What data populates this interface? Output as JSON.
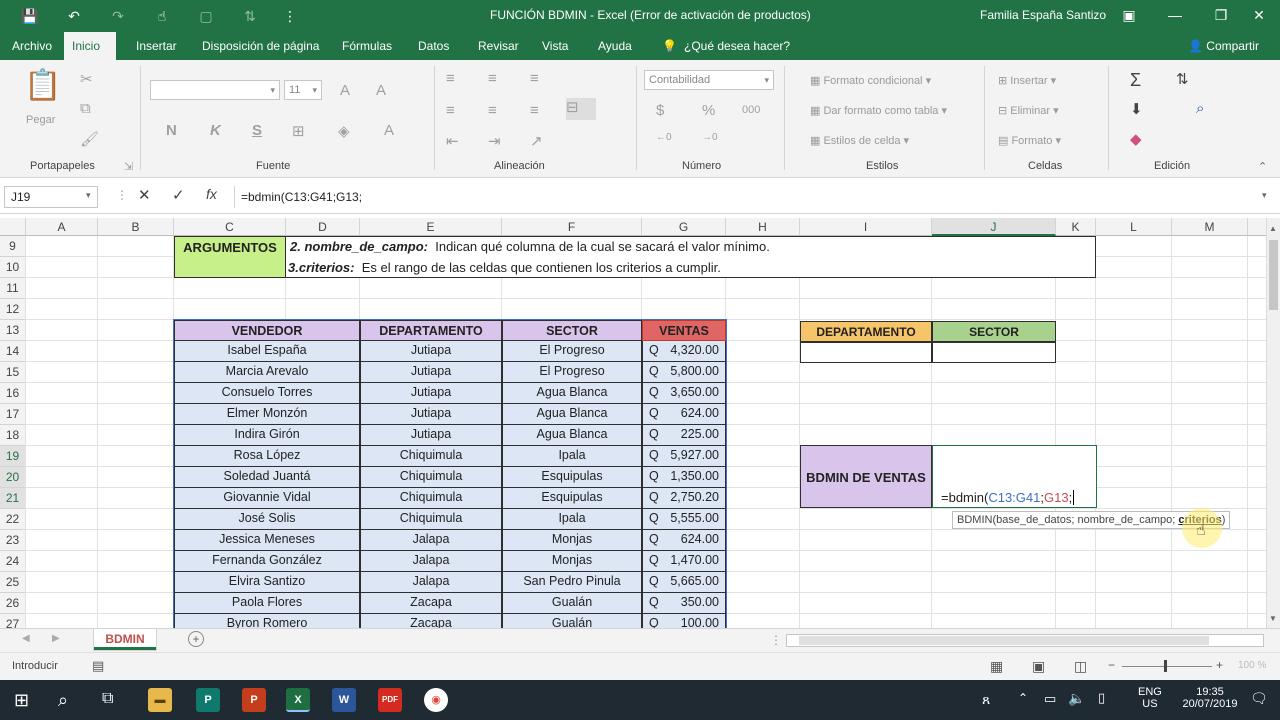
{
  "titlebar": {
    "title": "FUNCIÓN BDMIN  -  Excel (Error de activación de productos)",
    "user": "Familia España Santizo"
  },
  "tabs": [
    "Archivo",
    "Inicio",
    "Insertar",
    "Disposición de página",
    "Fórmulas",
    "Datos",
    "Revisar",
    "Vista",
    "Ayuda"
  ],
  "tell_me": "¿Qué desea hacer?",
  "share": "Compartir",
  "ribbon": {
    "pegar": "Pegar",
    "portapapeles": "Portapapeles",
    "fuente": "Fuente",
    "font_size": "11",
    "bold": "N",
    "italic": "K",
    "underline": "S",
    "alineacion": "Alineación",
    "numero": "Número",
    "number_format": "Contabilidad",
    "estilos": "Estilos",
    "formato_condicional": "Formato condicional",
    "dar_formato_tabla": "Dar formato como tabla",
    "estilos_celda": "Estilos de celda",
    "celdas": "Celdas",
    "insertar": "Insertar",
    "eliminar": "Eliminar",
    "formato": "Formato",
    "edicion": "Edición"
  },
  "formula_bar": {
    "name_box": "J19",
    "formula": "=bdmin(C13:G41;G13;"
  },
  "columns": [
    "A",
    "B",
    "C",
    "D",
    "E",
    "F",
    "G",
    "H",
    "I",
    "J",
    "K",
    "L",
    "M"
  ],
  "rows": [
    "9",
    "10",
    "11",
    "12",
    "13",
    "14",
    "15",
    "16",
    "17",
    "18",
    "19",
    "20",
    "21",
    "22",
    "23",
    "24",
    "25",
    "26",
    "27"
  ],
  "argumentos": {
    "label": "ARGUMENTOS",
    "line1_bold": "2. nombre_de_campo:",
    "line1_text": "Indican qué columna de la cual se sacará el valor mínimo.",
    "line2_bold": "3.criterios:",
    "line2_text": "Es el rango de las celdas que contienen los criterios a cumplir."
  },
  "table": {
    "headers": [
      "VENDEDOR",
      "DEPARTAMENTO",
      "SECTOR",
      "VENTAS"
    ],
    "currency": "Q",
    "rows": [
      [
        "Isabel España",
        "Jutiapa",
        "El Progreso",
        "4,320.00"
      ],
      [
        "Marcia Arevalo",
        "Jutiapa",
        "El Progreso",
        "5,800.00"
      ],
      [
        "Consuelo Torres",
        "Jutiapa",
        "Agua Blanca",
        "3,650.00"
      ],
      [
        "Elmer Monzón",
        "Jutiapa",
        "Agua Blanca",
        "624.00"
      ],
      [
        "Indira Girón",
        "Jutiapa",
        "Agua Blanca",
        "225.00"
      ],
      [
        "Rosa López",
        "Chiquimula",
        "Ipala",
        "5,927.00"
      ],
      [
        "Soledad Juantá",
        "Chiquimula",
        "Esquipulas",
        "1,350.00"
      ],
      [
        "Giovannie Vidal",
        "Chiquimula",
        "Esquipulas",
        "2,750.20"
      ],
      [
        "José Solis",
        "Chiquimula",
        "Ipala",
        "5,555.00"
      ],
      [
        "Jessica Meneses",
        "Jalapa",
        "Monjas",
        "624.00"
      ],
      [
        "Fernanda González",
        "Jalapa",
        "Monjas",
        "1,470.00"
      ],
      [
        "Elvira Santizo",
        "Jalapa",
        "San Pedro Pinula",
        "5,665.00"
      ],
      [
        "Paola Flores",
        "Zacapa",
        "Gualán",
        "350.00"
      ],
      [
        "Byron Romero",
        "Zacapa",
        "Gualán",
        "100.00"
      ]
    ]
  },
  "criteria": {
    "departamento": "DEPARTAMENTO",
    "sector": "SECTOR"
  },
  "bdmin": {
    "label": "BDMIN DE VENTAS",
    "formula_prefix": "=bdmin(",
    "formula_range": "C13:G41",
    "formula_sep": ";",
    "formula_field": "G13",
    "formula_end": ";",
    "tooltip_main": "BDMIN(base_de_datos; nombre_de_campo;",
    "tooltip_bold": "criterios",
    "tooltip_end": ")"
  },
  "sheet_tab": "BDMIN",
  "status": {
    "mode": "Introducir",
    "zoom": "100 %"
  },
  "taskbar": {
    "lang1": "ENG",
    "lang2": "US",
    "time": "19:35",
    "date": "20/07/2019"
  },
  "colors": {
    "excel_green": "#217346",
    "header_purple": "#d9c4ec",
    "header_red": "#e06666",
    "row_blue": "#dce6f5",
    "crit_orange": "#f6c56a",
    "crit_green": "#a9d18e",
    "arg_green": "#c7f08a"
  }
}
